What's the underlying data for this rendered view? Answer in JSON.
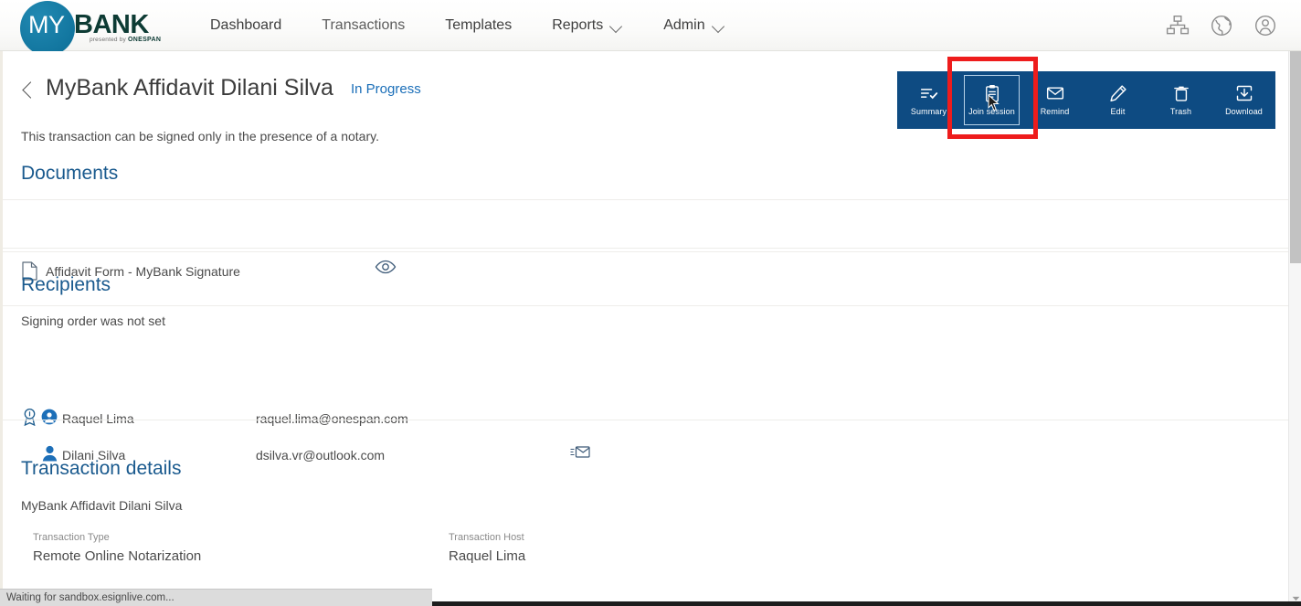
{
  "brand": {
    "logo_my": "MY",
    "logo_bank": "BANK",
    "logo_tagline_prefix": "presented by ",
    "logo_tagline_brand": "ONESPAN",
    "circle_color": "#12769f",
    "bank_color": "#0d3b34"
  },
  "nav": {
    "items": [
      {
        "label": "Dashboard",
        "has_caret": false
      },
      {
        "label": "Transactions",
        "has_caret": false
      },
      {
        "label": "Templates",
        "has_caret": false
      },
      {
        "label": "Reports",
        "has_caret": true
      },
      {
        "label": "Admin",
        "has_caret": true
      }
    ],
    "right_icons": [
      {
        "name": "sitemap-icon",
        "title": "Org chart"
      },
      {
        "name": "globe-icon",
        "title": "Language"
      },
      {
        "name": "user-account-icon",
        "title": "Account"
      }
    ]
  },
  "header": {
    "back_label": "Back",
    "title": "MyBank Affidavit Dilani Silva",
    "status": "In Progress",
    "status_color": "#1a6eb8",
    "notary_note": "This transaction can be signed only in the presence of a notary."
  },
  "toolbar": {
    "background": "#0e4b82",
    "selected": "Join session",
    "highlight_color": "#ee1c1c",
    "actions": [
      {
        "label": "Summary",
        "icon": "summary-list-check-icon"
      },
      {
        "label": "Join session",
        "icon": "clipboard-icon"
      },
      {
        "label": "Remind",
        "icon": "envelope-icon"
      },
      {
        "label": "Edit",
        "icon": "pencil-icon"
      },
      {
        "label": "Trash",
        "icon": "trash-icon"
      },
      {
        "label": "Download",
        "icon": "download-icon"
      }
    ]
  },
  "documents": {
    "heading": "Documents",
    "items": [
      {
        "name": "Affidavit Form - MyBank Signature",
        "file_icon": "document-file-icon",
        "preview_icon": "eye-icon"
      }
    ]
  },
  "recipients": {
    "heading": "Recipients",
    "signing_order_note": "Signing order was not set",
    "list": [
      {
        "name": "Raquel Lima",
        "email": "raquel.lima@onespan.com",
        "is_notary": true,
        "avatar_icon": "avatar-circle-icon",
        "notary_icon": "notary-seal-icon"
      },
      {
        "name": "Dilani Silva",
        "email": "dsilva.vr@outlook.com",
        "is_notary": false,
        "avatar_icon": "avatar-person-icon",
        "action_icon": "send-email-icon"
      }
    ]
  },
  "transaction_details": {
    "heading": "Transaction details",
    "name": "MyBank Affidavit Dilani Silva",
    "fields": [
      {
        "label": "Transaction Type",
        "value": "Remote Online Notarization"
      },
      {
        "label": "Transaction Host",
        "value": "Raquel Lima"
      }
    ]
  },
  "statusbar": {
    "message": "Waiting for sandbox.esignlive.com..."
  },
  "scrollbar": {
    "thumb_color": "#c2c2c2",
    "track_color": "#f6f6f6"
  }
}
